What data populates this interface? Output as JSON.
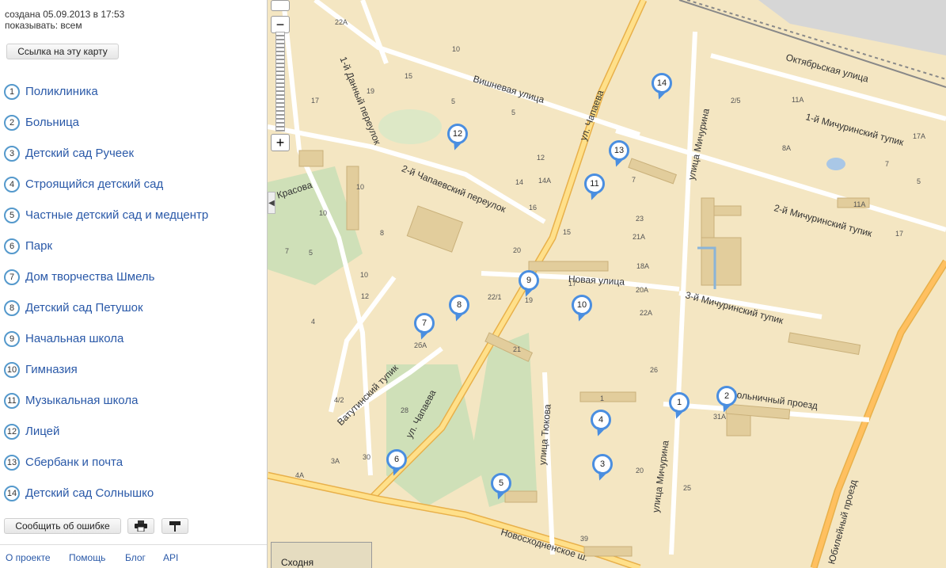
{
  "map_info": {
    "created": "создана 05.09.2013 в 17:53",
    "show": "показывать: всем"
  },
  "link_button": "Ссылка на эту карту",
  "places": [
    {
      "num": "1",
      "name": "Поликлиника"
    },
    {
      "num": "2",
      "name": "Больница"
    },
    {
      "num": "3",
      "name": "Детский сад Ручеек"
    },
    {
      "num": "4",
      "name": "Строящийся детский сад"
    },
    {
      "num": "5",
      "name": "Частные детский сад и медцентр"
    },
    {
      "num": "6",
      "name": "Парк"
    },
    {
      "num": "7",
      "name": "Дом творчества Шмель"
    },
    {
      "num": "8",
      "name": "Детский сад Петушок"
    },
    {
      "num": "9",
      "name": "Начальная школа"
    },
    {
      "num": "10",
      "name": "Гимназия"
    },
    {
      "num": "11",
      "name": "Музыкальная школа"
    },
    {
      "num": "12",
      "name": "Лицей"
    },
    {
      "num": "13",
      "name": "Сбербанк и почта"
    },
    {
      "num": "14",
      "name": "Детский сад Солнышко"
    }
  ],
  "actions": {
    "report": "Сообщить об ошибке",
    "print_icon": "printer-icon",
    "embed_icon": "embed-icon"
  },
  "footer": {
    "about": "О проекте",
    "help": "Помощь",
    "blog": "Блог",
    "api": "API"
  },
  "map": {
    "zoom_in": "+",
    "zoom_out": "−",
    "collapse": "◀",
    "minimap_label": "Сходня",
    "streets": {
      "chapaeva_n": "ул. Чапаева",
      "chapaeva_s": "ул. Чапаева",
      "vishnevaya": "Вишневая улица",
      "pereulok2chap": "2-й Чапаевский переулок",
      "danny": "1-й Данный переулок",
      "novaya": "Новая улица",
      "oktyabrskaya": "Октябрьская улица",
      "michurina": "улица Мичурина",
      "mich1": "1-й Мичуринский тупик",
      "mich2": "2-й Мичуринский тупик",
      "mich3": "3-й Мичуринский тупик",
      "bolnichny": "Больничный проезд",
      "tyukova": "улица Тюкова",
      "vatutinsky": "Ватутинский тупик",
      "novoskhod": "Новосходненское ш.",
      "krasova": "Красова",
      "yubileyny": "Юбилейный проезд"
    }
  }
}
